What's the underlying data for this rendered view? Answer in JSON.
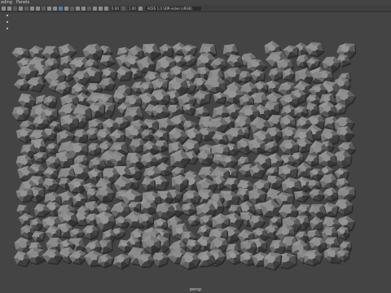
{
  "menubar": {
    "items": [
      {
        "label": "ading"
      },
      {
        "label": "Panels"
      }
    ]
  },
  "toolbar": {
    "exposure_value": "0.00",
    "gamma_value": "1.00",
    "colorspace": "ACES 1.0 SDR-video (sRGB)"
  },
  "viewport": {
    "camera_label": "persp",
    "background_color": "#444444",
    "rock_color": "#8d8d8d"
  }
}
